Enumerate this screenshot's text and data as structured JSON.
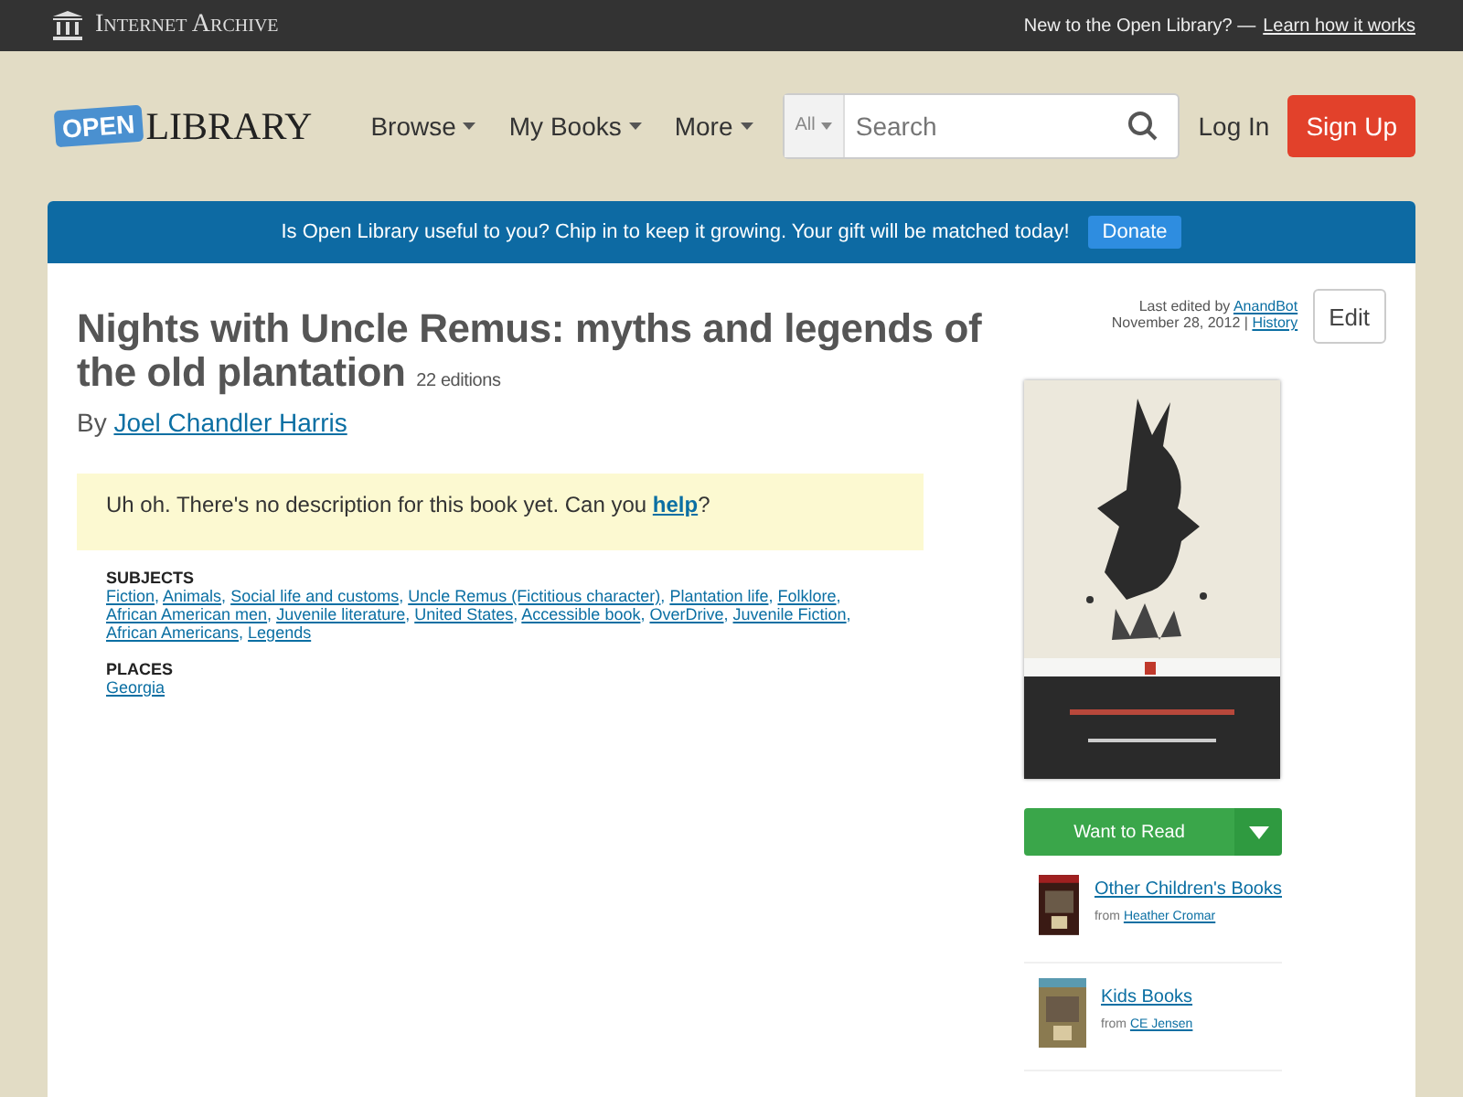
{
  "topbar": {
    "archive": "Internet Archive",
    "prompt": "New to the Open Library? —",
    "link": "Learn how it works"
  },
  "header": {
    "logo_sign": "OPEN",
    "logo_word": "LIBRARY",
    "nav": [
      "Browse",
      "My Books",
      "More"
    ],
    "search_scope": "All",
    "search": {
      "placeholder": "Search"
    },
    "login": "Log In",
    "signup": "Sign Up"
  },
  "banner": {
    "text": "Is Open Library useful to you? Chip in to keep it growing. Your gift will be matched today!",
    "button": "Donate"
  },
  "book": {
    "title": "Nights with Uncle Remus: myths and legends of the old plantation",
    "editions": "22 editions",
    "by": "By",
    "author": "Joel Chandler Harris",
    "edited": {
      "prefix": "Last edited by",
      "user": "AnandBot",
      "date": "November 28, 2012 |",
      "history": "History"
    },
    "edit": "Edit",
    "description": {
      "before": "Uh oh. There's no description for this book yet. Can you",
      "link": "help",
      "after": "?"
    },
    "subjects": {
      "heading": "SUBJECTS",
      "separator": ",",
      "items": [
        "Fiction",
        "Animals",
        "Social life and customs",
        "Uncle Remus (Fictitious character)",
        "Plantation life",
        "Folklore",
        "African American men",
        "Juvenile literature",
        "United States",
        "Accessible book",
        "OverDrive",
        "Juvenile Fiction",
        "African Americans",
        "Legends"
      ]
    },
    "places": {
      "heading": "PLACES",
      "items": [
        "Georgia"
      ]
    },
    "want": "Want to Read",
    "lists": [
      {
        "title": "Other Children's Books",
        "from": "from",
        "owner": "Heather Cromar"
      },
      {
        "title": "Kids Books",
        "from": "from",
        "owner": "CE Jensen"
      }
    ]
  }
}
